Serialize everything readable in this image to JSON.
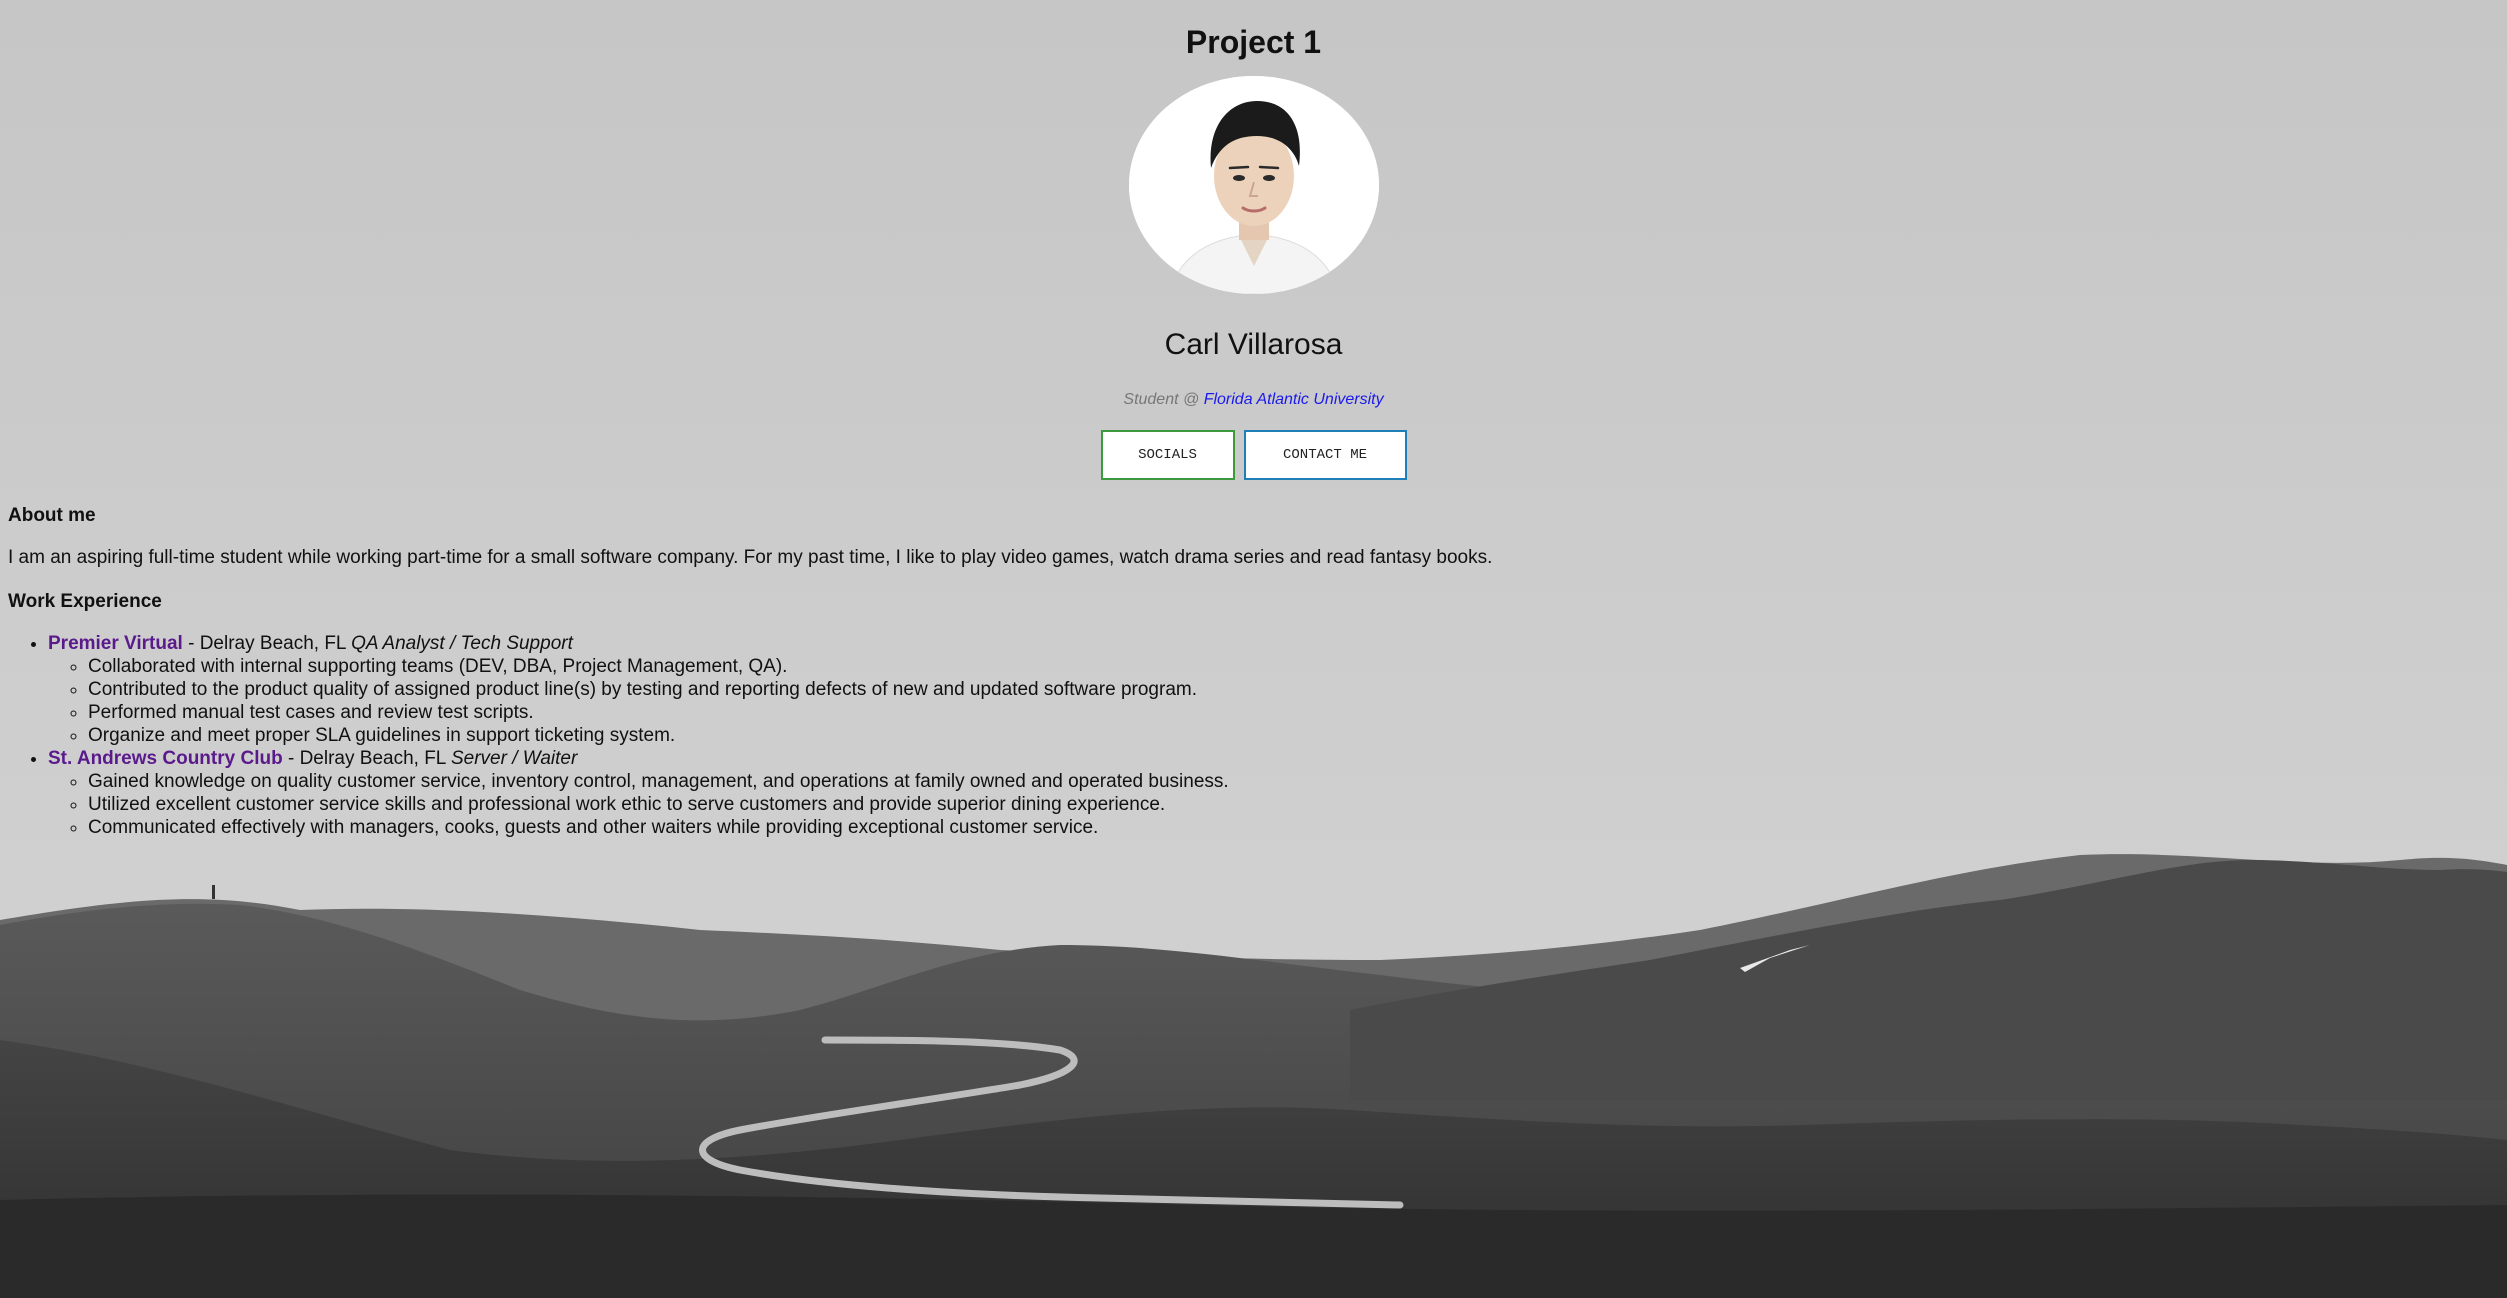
{
  "header": {
    "title": "Project 1"
  },
  "profile": {
    "name": "Carl Villarosa",
    "subtitle_prefix": "Student @ ",
    "subtitle_link": "Florida Atlantic University",
    "avatar_icon": "profile-photo",
    "buttons": {
      "socials": "SOCIALS",
      "contact": "CONTACT ME"
    },
    "colors": {
      "socials_border": "#3c9a3c",
      "contact_border": "#1f7fb8",
      "link": "#1a1aee",
      "company": "#5a1a8c"
    }
  },
  "about": {
    "heading": "About me",
    "text": "I am an aspiring full-time student while working part-time for a small software company. For my past time, I like to play video games, watch drama series and read fantasy books."
  },
  "work": {
    "heading": "Work Experience",
    "jobs": [
      {
        "company": "Premier Virtual",
        "location": " - Delray Beach, FL ",
        "role": "QA Analyst / Tech Support",
        "duties": [
          "Collaborated with internal supporting teams (DEV, DBA, Project Management, QA).",
          "Contributed to the product quality of assigned product line(s) by testing and reporting defects of new and updated software program.",
          "Performed manual test cases and review test scripts.",
          "Organize and meet proper SLA guidelines in support ticketing system."
        ]
      },
      {
        "company": "St. Andrews Country Club",
        "location": " - Delray Beach, FL ",
        "role": "Server / Waiter",
        "duties": [
          "Gained knowledge on quality customer service, inventory control, management, and operations at family owned and operated business.",
          "Utilized excellent customer service skills and professional work ethic to serve customers and provide superior dining experience.",
          "Communicated effectively with managers, cooks, guests and other waiters while providing exceptional customer service."
        ]
      }
    ]
  }
}
